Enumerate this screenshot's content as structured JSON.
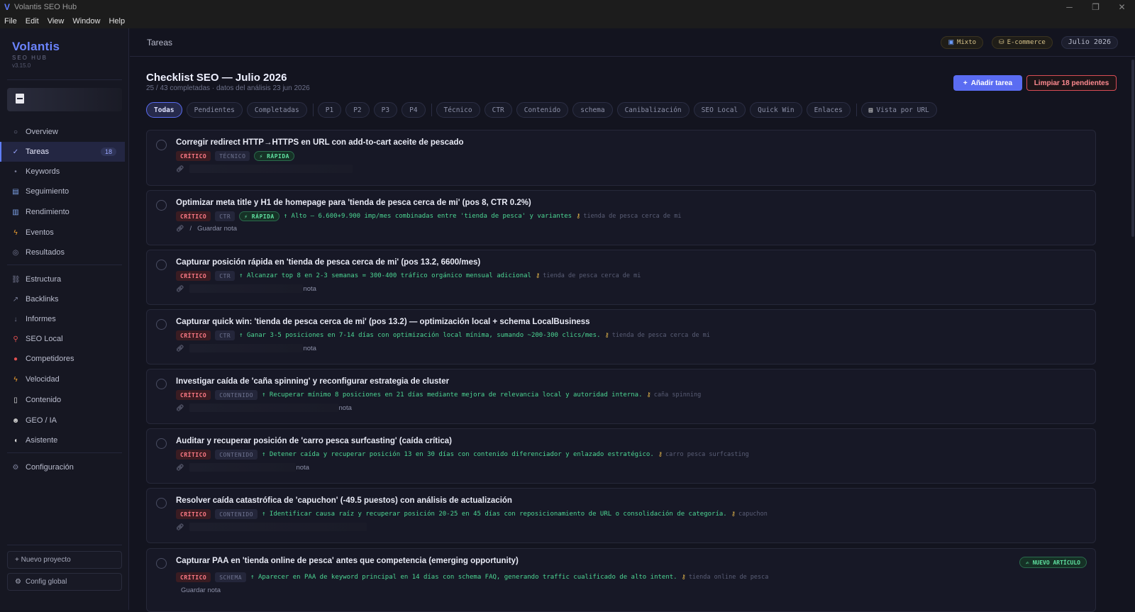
{
  "window": {
    "title": "Volantis SEO Hub"
  },
  "menu": [
    "File",
    "Edit",
    "View",
    "Window",
    "Help"
  ],
  "sidebar": {
    "brand": "Volantis",
    "brand_sub": "SEO HUB",
    "version": "v3.15.0",
    "nav": [
      {
        "label": "Overview",
        "icon": "circle-icon"
      },
      {
        "label": "Tareas",
        "icon": "check-icon",
        "badge": "18",
        "active": true
      },
      {
        "label": "Keywords",
        "icon": "dot-icon"
      },
      {
        "label": "Seguimiento",
        "icon": "chart-icon"
      },
      {
        "label": "Rendimiento",
        "icon": "bar-chart-icon"
      },
      {
        "label": "Eventos",
        "icon": "lightning-icon"
      },
      {
        "label": "Resultados",
        "icon": "target-icon"
      },
      {
        "label": "Estructura",
        "icon": "link-icon"
      },
      {
        "label": "Backlinks",
        "icon": "arrow-icon"
      },
      {
        "label": "Informes",
        "icon": "download-icon"
      },
      {
        "label": "SEO Local",
        "icon": "pin-icon"
      },
      {
        "label": "Competidores",
        "icon": "red-dot-icon"
      },
      {
        "label": "Velocidad",
        "icon": "lightning-icon"
      },
      {
        "label": "Contenido",
        "icon": "document-icon"
      },
      {
        "label": "GEO / IA",
        "icon": "robot-icon"
      },
      {
        "label": "Asistente",
        "icon": "chat-icon"
      },
      {
        "label": "Configuración",
        "icon": "gear-icon"
      }
    ],
    "new_project": "+ Nuevo proyecto",
    "global_config": "Config global"
  },
  "header": {
    "title": "Tareas",
    "pill_mixed": "Mixto",
    "pill_ecommerce": "E-commerce",
    "date": "Julio 2026"
  },
  "main": {
    "title": "Checklist SEO — Julio 2026",
    "subtitle": "25 / 43 completadas · datos del análisis 23 jun 2026",
    "add_button": "Añadir tarea",
    "clear_button": "Limpiar 18 pendientes",
    "filters": {
      "status": [
        "Todas",
        "Pendientes",
        "Completadas"
      ],
      "priority": [
        "P1",
        "P2",
        "P3",
        "P4"
      ],
      "category": [
        "Técnico",
        "CTR",
        "Contenido",
        "schema",
        "Canibalización",
        "SEO Local",
        "Quick Win",
        "Enlaces"
      ],
      "url_view": "Vista por URL"
    },
    "tasks": [
      {
        "title": "Corregir redirect HTTP→HTTPS en URL con add-to-cart aceite de pescado",
        "severity": "CRÍTICO",
        "category": "TÉCNICO",
        "fast": "⚡ RÁPIDA",
        "impact": "",
        "keyword": "",
        "note": ""
      },
      {
        "title": "Optimizar meta title y H1 de homepage para 'tienda de pesca cerca de mi' (pos 8, CTR 0.2%)",
        "severity": "CRÍTICO",
        "category": "CTR",
        "fast": "⚡ RÁPIDA",
        "impact": "↑ Alto — 6.600+9.900 imp/mes combinadas entre 'tienda de pesca' y variantes",
        "keyword": "tienda de pesca cerca de mi",
        "note": "Guardar nota"
      },
      {
        "title": "Capturar posición rápida en 'tienda de pesca cerca de mi' (pos 13.2, 6600/mes)",
        "severity": "CRÍTICO",
        "category": "CTR",
        "fast": "",
        "impact": "↑ Alcanzar top 8 en 2-3 semanas = 300-400 tráfico orgánico mensual adicional",
        "keyword": "tienda de pesca cerca de mi",
        "note": "nota"
      },
      {
        "title": "Capturar quick win: 'tienda de pesca cerca de mi' (pos 13.2) — optimización local + schema LocalBusiness",
        "severity": "CRÍTICO",
        "category": "CTR",
        "fast": "",
        "impact": "↑ Ganar 3-5 posiciones en 7-14 días con optimización local mínima, sumando ~200-300 clics/mes.",
        "keyword": "tienda de pesca cerca de mi",
        "note": "nota"
      },
      {
        "title": "Investigar caída de 'caña spinning' y reconfigurar estrategia de cluster",
        "severity": "CRÍTICO",
        "category": "CONTENIDO",
        "fast": "",
        "impact": "↑ Recuperar mínimo 8 posiciones en 21 días mediante mejora de relevancia local y autoridad interna.",
        "keyword": "caña spinning",
        "note": "nota"
      },
      {
        "title": "Auditar y recuperar posición de 'carro pesca surfcasting' (caída crítica)",
        "severity": "CRÍTICO",
        "category": "CONTENIDO",
        "fast": "",
        "impact": "↑ Detener caída y recuperar posición 13 en 30 días con contenido diferenciador y enlazado estratégico.",
        "keyword": "carro pesca surfcasting",
        "note": "nota"
      },
      {
        "title": "Resolver caída catastrófica de 'capuchon' (-49.5 puestos) con análisis de actualización",
        "severity": "CRÍTICO",
        "category": "CONTENIDO",
        "fast": "",
        "impact": "↑ Identificar causa raíz y recuperar posición 20-25 en 45 días con reposicionamiento de URL o consolidación de categoría.",
        "keyword": "capuchon",
        "note": ""
      },
      {
        "title": "Capturar PAA en 'tienda online de pesca' antes que competencia (emerging opportunity)",
        "severity": "CRÍTICO",
        "category": "SCHEMA",
        "fast": "",
        "impact": "↑ Aparecer en PAA de keyword principal en 14 días con schema FAQ, generando traffic cualificado de alto intent.",
        "keyword": "tienda online de pesca",
        "note": "Guardar nota",
        "badge": "✍ NUEVO ARTÍCULO"
      }
    ]
  }
}
